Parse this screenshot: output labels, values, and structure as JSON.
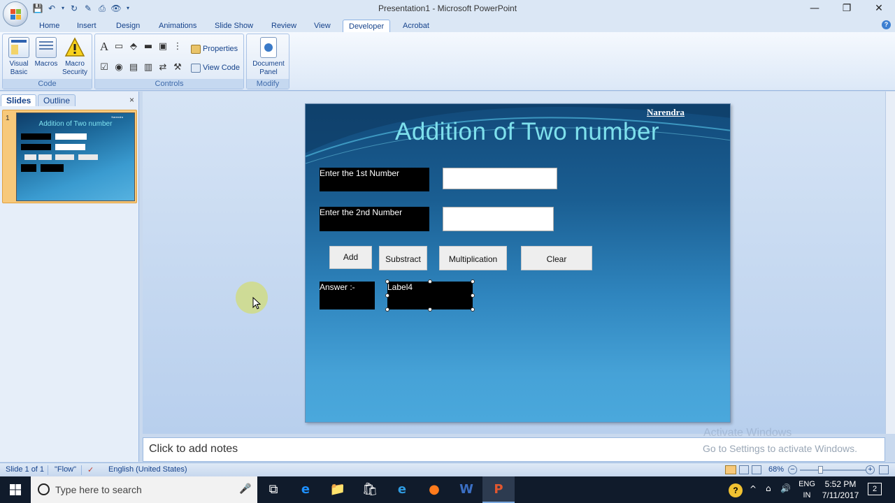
{
  "window": {
    "title": "Presentation1 - Microsoft PowerPoint",
    "controls": [
      "—",
      "❐",
      "✕"
    ]
  },
  "tabs": [
    "Home",
    "Insert",
    "Design",
    "Animations",
    "Slide Show",
    "Review",
    "View",
    "Developer",
    "Acrobat"
  ],
  "active_tab": "Developer",
  "ribbon": {
    "code": {
      "label": "Code",
      "visual_basic": [
        "Visual",
        "Basic"
      ],
      "macros": "Macros",
      "macro_security": [
        "Macro",
        "Security"
      ]
    },
    "controls": {
      "label": "Controls",
      "properties": "Properties",
      "view_code": "View Code"
    },
    "modify": {
      "label": "Modify",
      "document_panel": [
        "Document",
        "Panel"
      ]
    }
  },
  "left_panel": {
    "tabs": [
      "Slides",
      "Outline"
    ],
    "active_tab": "Slides",
    "close": "×",
    "slide_number": "1"
  },
  "slide": {
    "title": "Addition of Two number",
    "author": "Narendra",
    "label1": "Enter the 1st Number",
    "label2": "Enter the 2nd Number",
    "buttons": [
      "Add",
      "Substract",
      "Multiplication",
      "Clear"
    ],
    "answer_label": "Answer :-",
    "result_label": "Label4"
  },
  "thumbnail": {
    "title": "Addition  of Two number",
    "author": "Narendra"
  },
  "notes": {
    "placeholder": "Click to add notes"
  },
  "watermark": {
    "line1": "Activate Windows",
    "line2": "Go to Settings to activate Windows."
  },
  "status_bar": {
    "slide": "Slide 1 of 1",
    "theme": "\"Flow\"",
    "language": "English (United States)",
    "zoom": "68%"
  },
  "taskbar": {
    "search_placeholder": "Type here to search",
    "lang": [
      "ENG",
      "IN"
    ],
    "time": "5:52 PM",
    "date": "7/11/2017",
    "notifications": "2"
  }
}
